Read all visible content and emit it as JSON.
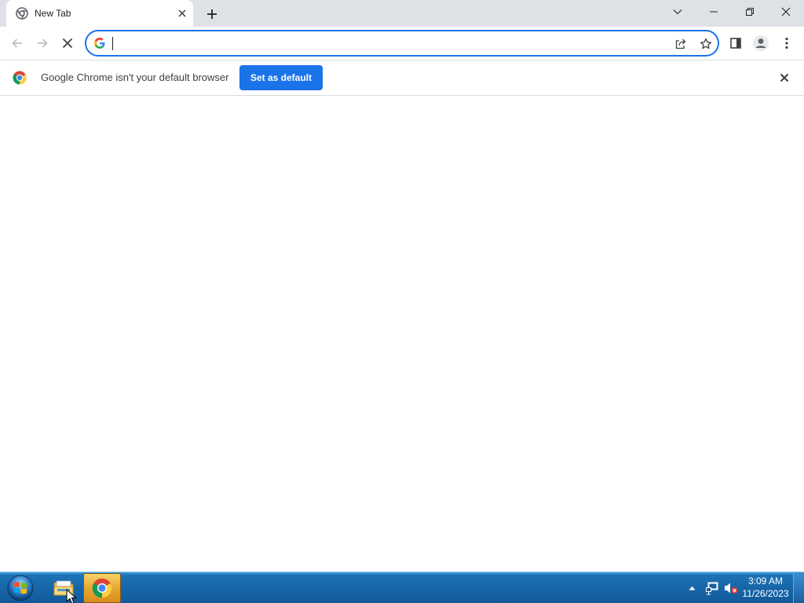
{
  "window": {
    "tab": {
      "title": "New Tab",
      "favicon": "chrome-newtab-icon",
      "close_icon": "close-icon"
    },
    "new_tab_icon": "plus-icon",
    "controls": [
      "chevron-down-icon",
      "minimize-icon",
      "restore-icon",
      "close-icon"
    ]
  },
  "toolbar": {
    "back_icon": "arrow-left-icon",
    "forward_icon": "arrow-right-icon",
    "stop_icon": "close-icon",
    "omnibox": {
      "value": "",
      "placeholder": "",
      "search_engine_icon": "google-g-icon"
    },
    "share_icon": "share-icon",
    "bookmark_icon": "star-icon",
    "side_panel_icon": "side-panel-icon",
    "profile_icon": "person-icon",
    "menu_icon": "kebab-menu-icon"
  },
  "infobar": {
    "message": "Google Chrome isn't your default browser",
    "button_label": "Set as default",
    "close_icon": "close-icon"
  },
  "taskbar": {
    "start_icon": "windows-start-orb-icon",
    "apps": [
      "folder-icon",
      "chrome-icon"
    ],
    "tray": {
      "arrow_icon": "chevron-up-icon",
      "network_icon": "network-icon",
      "volume_icon": "volume-muted-icon",
      "time": "3:09 AM",
      "date": "11/26/2023"
    }
  },
  "colors": {
    "accent": "#1a73e8",
    "tabstrip": "#dee1e6",
    "taskbar": "#1767a8"
  }
}
